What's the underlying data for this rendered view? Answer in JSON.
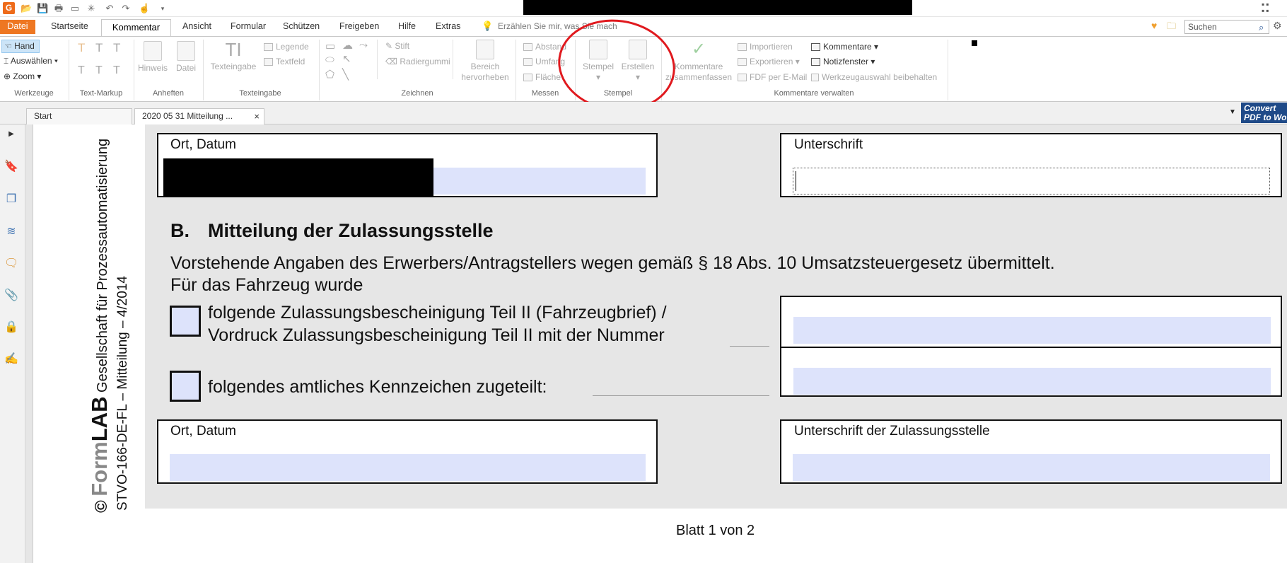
{
  "app": {
    "logo_letter": "G",
    "title_redacted": true
  },
  "menu_tabs": [
    "Datei",
    "Startseite",
    "Kommentar",
    "Ansicht",
    "Formular",
    "Schützen",
    "Freigeben",
    "Hilfe",
    "Extras"
  ],
  "tell_me": "Erzählen Sie mir, was Sie mach",
  "search": {
    "placeholder": "Suchen"
  },
  "ribbon": {
    "werkzeuge": {
      "hand": "Hand",
      "auswaehlen": "Auswählen",
      "zoom": "Zoom",
      "label": "Werkzeuge"
    },
    "text_markup": {
      "label": "Text-Markup"
    },
    "anheften": {
      "hinweis": "Hinweis",
      "datei": "Datei",
      "label": "Anheften"
    },
    "texteingabe": {
      "texteingabe": "Texteingabe",
      "legende": "Legende",
      "textfeld": "Textfeld",
      "label": "Texteingabe"
    },
    "zeichnen": {
      "stift": "Stift",
      "radiergummi": "Radiergummi",
      "bereich1": "Bereich",
      "bereich2": "hervorheben",
      "label": "Zeichnen"
    },
    "messen": {
      "abstand": "Abstand",
      "umfang": "Umfang",
      "flaeche": "Fläche",
      "label": "Messen"
    },
    "stempel": {
      "stempel": "Stempel",
      "erstellen": "Erstellen",
      "label": "Stempel"
    },
    "kommentare": {
      "zus1": "Kommentare",
      "zus2": "zusammenfassen",
      "importieren": "Importieren",
      "exportieren": "Exportieren",
      "fdf": "FDF per E-Mail",
      "kommentare_dd": "Kommentare",
      "notizfenster": "Notizfenster",
      "werkzeugauswahl": "Werkzeugauswahl beibehalten",
      "label": "Kommentare verwalten"
    }
  },
  "doc_tabs": {
    "start": "Start",
    "doc": "2020 05 31 Mitteilung ..."
  },
  "convert": {
    "line1": "Convert",
    "line2": "PDF to Wo"
  },
  "form": {
    "ort_datum_1": "Ort, Datum",
    "unterschrift_1": "Unterschrift",
    "section_letter": "B.",
    "section_title": "Mitteilung der Zulassungsstelle",
    "para_line1": "Vorstehende Angaben des Erwerbers/Antragstellers wegen gemäß § 18 Abs. 10 Umsatzsteuergesetz übermittelt.",
    "para_line2": "Für das Fahrzeug wurde",
    "opt1_line1": "folgende Zulassungsbescheinigung Teil II (Fahrzeugbrief) /",
    "opt1_line2": "Vordruck Zulassungsbescheinigung Teil II mit der Nummer",
    "opt2": "folgendes amtliches Kennzeichen zugeteilt:",
    "ort_datum_2": "Ort, Datum",
    "unterschrift_2": "Unterschrift der Zulassungsstelle",
    "footer": "Blatt 1 von 2"
  },
  "margin": {
    "copyright": "©",
    "brand_form": "Form",
    "brand_lab": "LAB",
    "company": "Gesellschaft für Prozessautomatisierung",
    "code": "STVO-166-DE-FL – Mitteilung – 4/2014"
  }
}
